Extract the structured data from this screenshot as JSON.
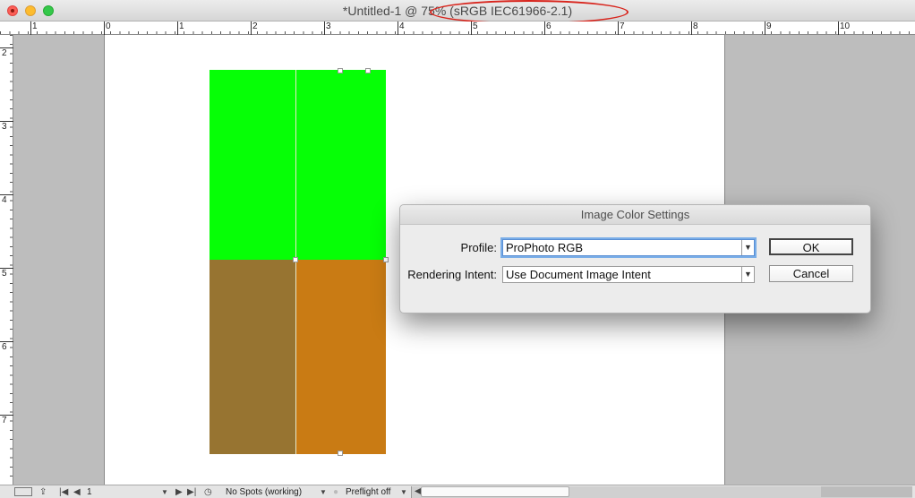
{
  "window": {
    "title": "*Untitled-1 @ 75% (sRGB IEC61966-2.1)"
  },
  "ruler": {
    "top_labels": [
      "1",
      "0",
      "1",
      "2",
      "3",
      "4",
      "5",
      "6",
      "7",
      "8",
      "9",
      "10"
    ],
    "left_labels": [
      "2",
      "3",
      "4",
      "5",
      "6",
      "7"
    ]
  },
  "canvas": {
    "colors": {
      "green": "#06ff06",
      "olive_brown": "#977431",
      "orange_brown": "#c97b14"
    }
  },
  "dialog": {
    "title": "Image Color Settings",
    "profile_label": "Profile:",
    "profile_value": "ProPhoto RGB",
    "intent_label": "Rendering Intent:",
    "intent_value": "Use Document Image Intent",
    "ok_label": "OK",
    "cancel_label": "Cancel"
  },
  "statusbar": {
    "page_number": "1",
    "spots_label": "No Spots (working)",
    "preflight_label": "Preflight off"
  },
  "annotation": {
    "color": "#d8241c"
  }
}
